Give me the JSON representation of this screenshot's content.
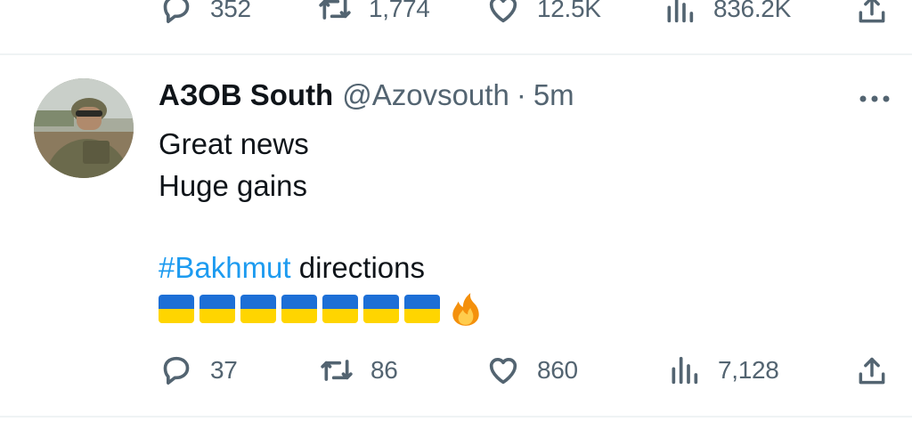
{
  "prev_tweet": {
    "replies": "352",
    "retweets": "1,774",
    "likes": "12.5K",
    "views": "836.2K"
  },
  "tweet": {
    "display_name": "АЗОВ South",
    "handle": "@Azovsouth",
    "separator": "·",
    "time": "5m",
    "lines": [
      "Great news",
      "Huge gains"
    ],
    "hashtag": "#Bakhmut",
    "hashtag_suffix": " directions",
    "emoji": {
      "flags": [
        "ukraine-flag",
        "ukraine-flag",
        "ukraine-flag",
        "ukraine-flag",
        "ukraine-flag",
        "ukraine-flag",
        "ukraine-flag"
      ],
      "trailing": "fire-icon"
    },
    "replies": "37",
    "retweets": "86",
    "likes": "860",
    "views": "7,128"
  },
  "colors": {
    "text": "#0f1419",
    "secondary": "#536471",
    "link": "#1d9bf0",
    "divider": "#eff3f4",
    "flag_blue": "#1d6fd6",
    "flag_yellow": "#ffd500"
  },
  "icons": {
    "reply": "reply-icon",
    "retweet": "retweet-icon",
    "like": "heart-icon",
    "views": "views-icon",
    "share": "share-icon",
    "more": "more-icon"
  }
}
